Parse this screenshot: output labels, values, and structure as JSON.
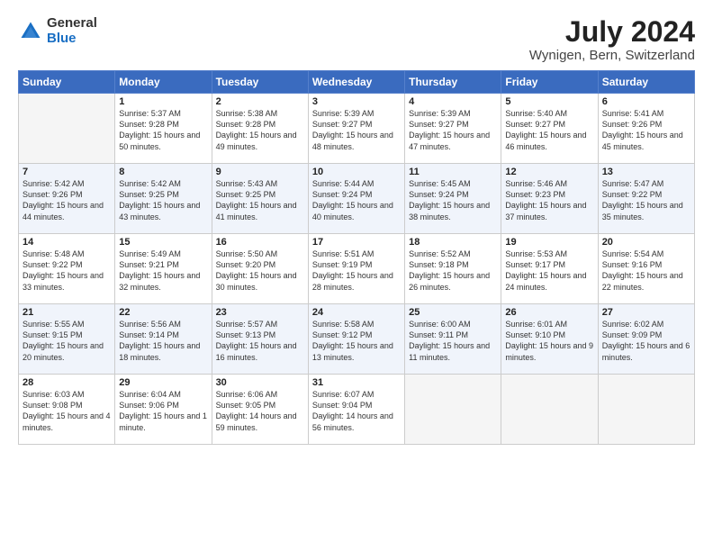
{
  "logo": {
    "general": "General",
    "blue": "Blue"
  },
  "title": "July 2024",
  "subtitle": "Wynigen, Bern, Switzerland",
  "days_of_week": [
    "Sunday",
    "Monday",
    "Tuesday",
    "Wednesday",
    "Thursday",
    "Friday",
    "Saturday"
  ],
  "weeks": [
    [
      {
        "day": "",
        "empty": true
      },
      {
        "day": "1",
        "sunrise": "Sunrise: 5:37 AM",
        "sunset": "Sunset: 9:28 PM",
        "daylight": "Daylight: 15 hours and 50 minutes."
      },
      {
        "day": "2",
        "sunrise": "Sunrise: 5:38 AM",
        "sunset": "Sunset: 9:28 PM",
        "daylight": "Daylight: 15 hours and 49 minutes."
      },
      {
        "day": "3",
        "sunrise": "Sunrise: 5:39 AM",
        "sunset": "Sunset: 9:27 PM",
        "daylight": "Daylight: 15 hours and 48 minutes."
      },
      {
        "day": "4",
        "sunrise": "Sunrise: 5:39 AM",
        "sunset": "Sunset: 9:27 PM",
        "daylight": "Daylight: 15 hours and 47 minutes."
      },
      {
        "day": "5",
        "sunrise": "Sunrise: 5:40 AM",
        "sunset": "Sunset: 9:27 PM",
        "daylight": "Daylight: 15 hours and 46 minutes."
      },
      {
        "day": "6",
        "sunrise": "Sunrise: 5:41 AM",
        "sunset": "Sunset: 9:26 PM",
        "daylight": "Daylight: 15 hours and 45 minutes."
      }
    ],
    [
      {
        "day": "7",
        "sunrise": "Sunrise: 5:42 AM",
        "sunset": "Sunset: 9:26 PM",
        "daylight": "Daylight: 15 hours and 44 minutes."
      },
      {
        "day": "8",
        "sunrise": "Sunrise: 5:42 AM",
        "sunset": "Sunset: 9:25 PM",
        "daylight": "Daylight: 15 hours and 43 minutes."
      },
      {
        "day": "9",
        "sunrise": "Sunrise: 5:43 AM",
        "sunset": "Sunset: 9:25 PM",
        "daylight": "Daylight: 15 hours and 41 minutes."
      },
      {
        "day": "10",
        "sunrise": "Sunrise: 5:44 AM",
        "sunset": "Sunset: 9:24 PM",
        "daylight": "Daylight: 15 hours and 40 minutes."
      },
      {
        "day": "11",
        "sunrise": "Sunrise: 5:45 AM",
        "sunset": "Sunset: 9:24 PM",
        "daylight": "Daylight: 15 hours and 38 minutes."
      },
      {
        "day": "12",
        "sunrise": "Sunrise: 5:46 AM",
        "sunset": "Sunset: 9:23 PM",
        "daylight": "Daylight: 15 hours and 37 minutes."
      },
      {
        "day": "13",
        "sunrise": "Sunrise: 5:47 AM",
        "sunset": "Sunset: 9:22 PM",
        "daylight": "Daylight: 15 hours and 35 minutes."
      }
    ],
    [
      {
        "day": "14",
        "sunrise": "Sunrise: 5:48 AM",
        "sunset": "Sunset: 9:22 PM",
        "daylight": "Daylight: 15 hours and 33 minutes."
      },
      {
        "day": "15",
        "sunrise": "Sunrise: 5:49 AM",
        "sunset": "Sunset: 9:21 PM",
        "daylight": "Daylight: 15 hours and 32 minutes."
      },
      {
        "day": "16",
        "sunrise": "Sunrise: 5:50 AM",
        "sunset": "Sunset: 9:20 PM",
        "daylight": "Daylight: 15 hours and 30 minutes."
      },
      {
        "day": "17",
        "sunrise": "Sunrise: 5:51 AM",
        "sunset": "Sunset: 9:19 PM",
        "daylight": "Daylight: 15 hours and 28 minutes."
      },
      {
        "day": "18",
        "sunrise": "Sunrise: 5:52 AM",
        "sunset": "Sunset: 9:18 PM",
        "daylight": "Daylight: 15 hours and 26 minutes."
      },
      {
        "day": "19",
        "sunrise": "Sunrise: 5:53 AM",
        "sunset": "Sunset: 9:17 PM",
        "daylight": "Daylight: 15 hours and 24 minutes."
      },
      {
        "day": "20",
        "sunrise": "Sunrise: 5:54 AM",
        "sunset": "Sunset: 9:16 PM",
        "daylight": "Daylight: 15 hours and 22 minutes."
      }
    ],
    [
      {
        "day": "21",
        "sunrise": "Sunrise: 5:55 AM",
        "sunset": "Sunset: 9:15 PM",
        "daylight": "Daylight: 15 hours and 20 minutes."
      },
      {
        "day": "22",
        "sunrise": "Sunrise: 5:56 AM",
        "sunset": "Sunset: 9:14 PM",
        "daylight": "Daylight: 15 hours and 18 minutes."
      },
      {
        "day": "23",
        "sunrise": "Sunrise: 5:57 AM",
        "sunset": "Sunset: 9:13 PM",
        "daylight": "Daylight: 15 hours and 16 minutes."
      },
      {
        "day": "24",
        "sunrise": "Sunrise: 5:58 AM",
        "sunset": "Sunset: 9:12 PM",
        "daylight": "Daylight: 15 hours and 13 minutes."
      },
      {
        "day": "25",
        "sunrise": "Sunrise: 6:00 AM",
        "sunset": "Sunset: 9:11 PM",
        "daylight": "Daylight: 15 hours and 11 minutes."
      },
      {
        "day": "26",
        "sunrise": "Sunrise: 6:01 AM",
        "sunset": "Sunset: 9:10 PM",
        "daylight": "Daylight: 15 hours and 9 minutes."
      },
      {
        "day": "27",
        "sunrise": "Sunrise: 6:02 AM",
        "sunset": "Sunset: 9:09 PM",
        "daylight": "Daylight: 15 hours and 6 minutes."
      }
    ],
    [
      {
        "day": "28",
        "sunrise": "Sunrise: 6:03 AM",
        "sunset": "Sunset: 9:08 PM",
        "daylight": "Daylight: 15 hours and 4 minutes."
      },
      {
        "day": "29",
        "sunrise": "Sunrise: 6:04 AM",
        "sunset": "Sunset: 9:06 PM",
        "daylight": "Daylight: 15 hours and 1 minute."
      },
      {
        "day": "30",
        "sunrise": "Sunrise: 6:06 AM",
        "sunset": "Sunset: 9:05 PM",
        "daylight": "Daylight: 14 hours and 59 minutes."
      },
      {
        "day": "31",
        "sunrise": "Sunrise: 6:07 AM",
        "sunset": "Sunset: 9:04 PM",
        "daylight": "Daylight: 14 hours and 56 minutes."
      },
      {
        "day": "",
        "empty": true
      },
      {
        "day": "",
        "empty": true
      },
      {
        "day": "",
        "empty": true
      }
    ]
  ]
}
